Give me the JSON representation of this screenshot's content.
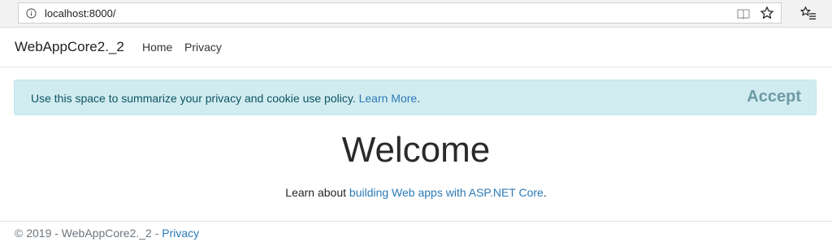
{
  "browser": {
    "url": "localhost:8000/",
    "icons": [
      "info-icon",
      "reading-view-icon",
      "favorite-star-icon",
      "favorites-list-icon"
    ]
  },
  "navbar": {
    "brand": "WebAppCore2._2",
    "links": [
      {
        "label": "Home"
      },
      {
        "label": "Privacy"
      }
    ]
  },
  "consent": {
    "message": "Use this space to summarize your privacy and cookie use policy.",
    "link_label": "Learn More",
    "trailing": ".",
    "accept_label": "Accept"
  },
  "main": {
    "title": "Welcome",
    "learn_prefix": "Learn about",
    "learn_link": "building Web apps with ASP.NET Core",
    "learn_suffix": "."
  },
  "footer": {
    "copyright": "© 2019 - WebAppCore2._2 -",
    "privacy_label": "Privacy"
  },
  "colors": {
    "link": "#2a7ab7",
    "consent_bg": "#d1ecf1",
    "consent_text": "#0c5460"
  }
}
